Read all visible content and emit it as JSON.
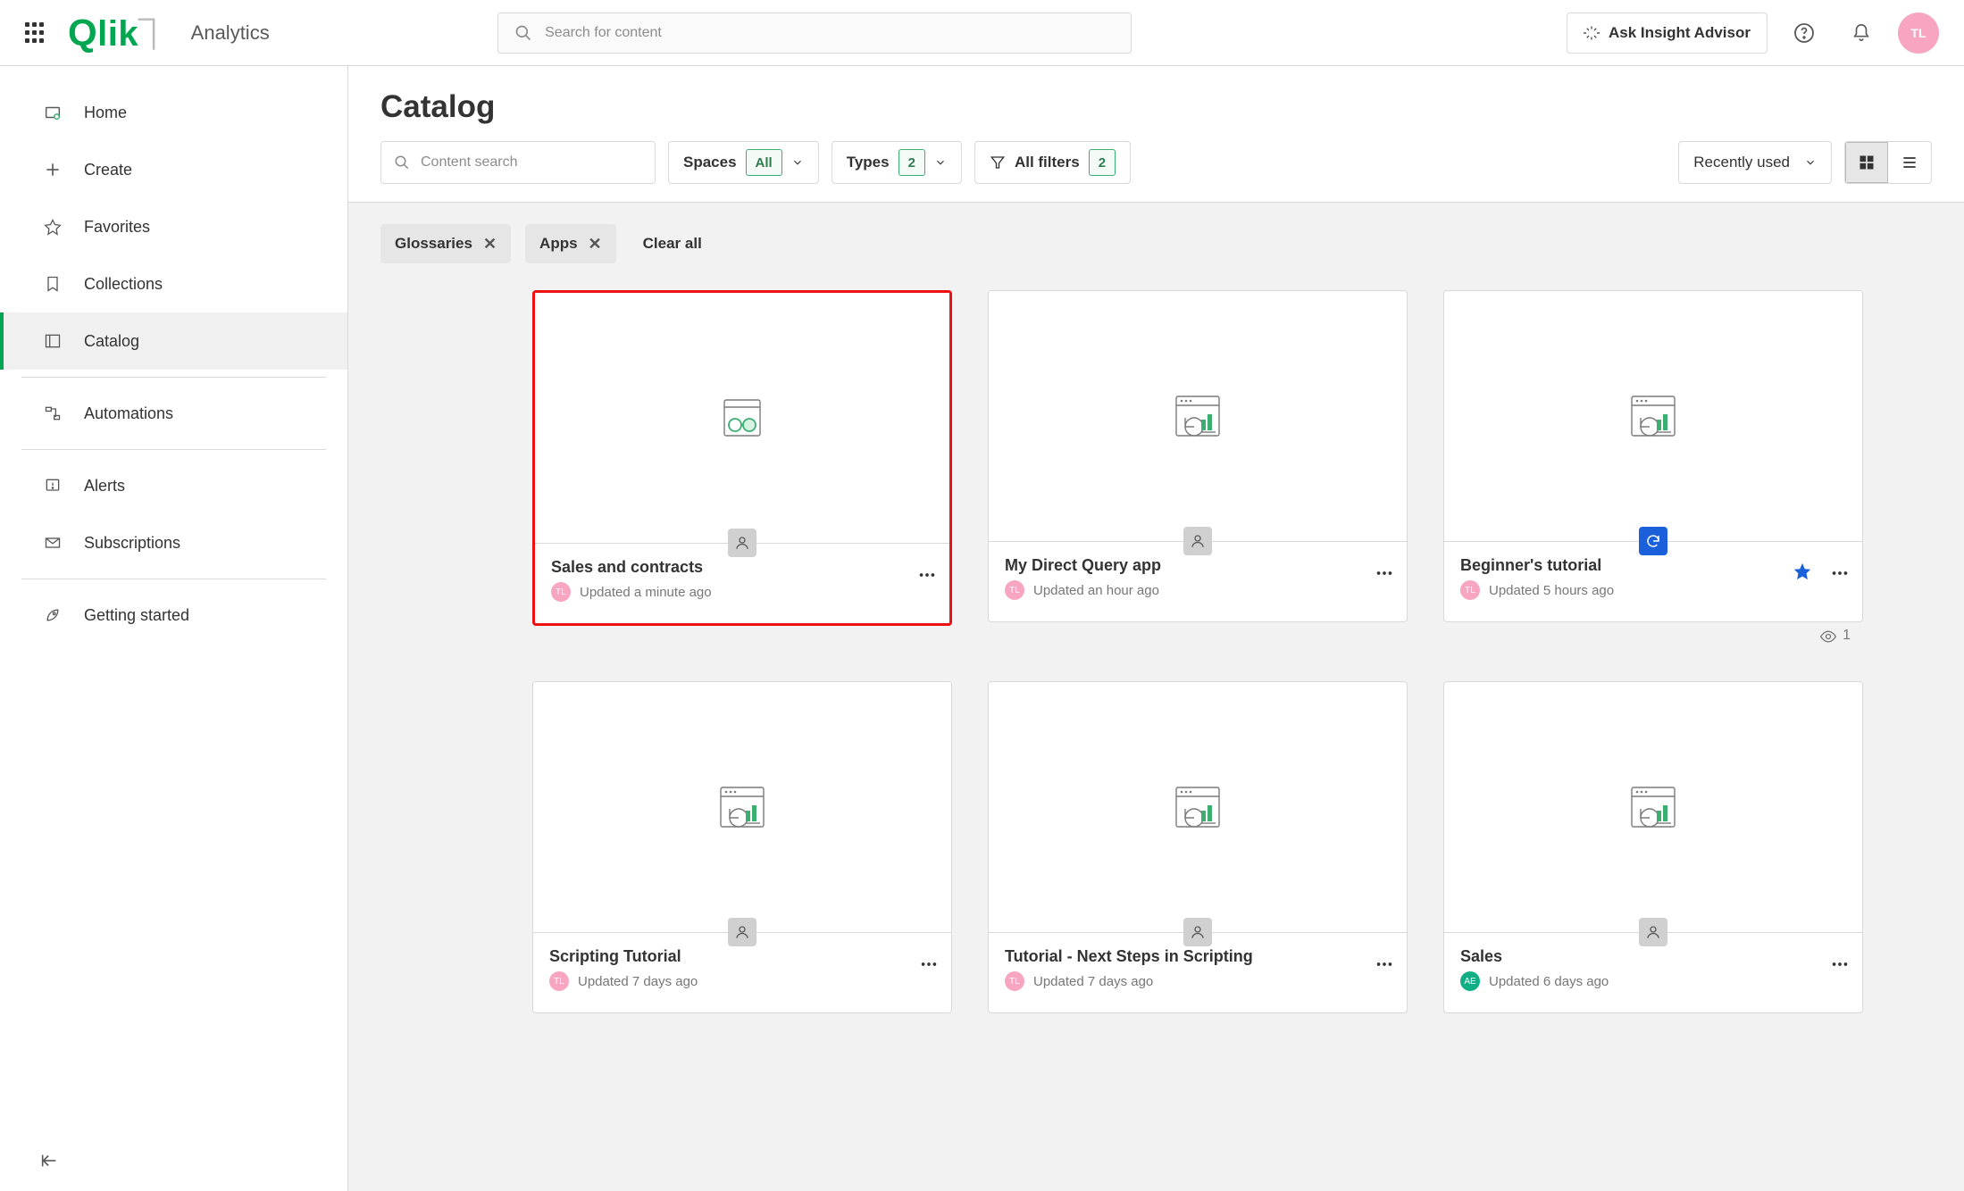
{
  "top": {
    "search_placeholder": "Search for content",
    "ask_label": "Ask Insight Advisor",
    "avatar_initials": "TL",
    "breadcrumb": "Analytics"
  },
  "sidebar": {
    "items": [
      {
        "label": "Home"
      },
      {
        "label": "Create"
      },
      {
        "label": "Favorites"
      },
      {
        "label": "Collections"
      },
      {
        "label": "Catalog"
      },
      {
        "label": "Automations"
      },
      {
        "label": "Alerts"
      },
      {
        "label": "Subscriptions"
      },
      {
        "label": "Getting started"
      }
    ]
  },
  "page": {
    "title": "Catalog",
    "content_search_placeholder": "Content search",
    "spaces_label": "Spaces",
    "spaces_badge": "All",
    "types_label": "Types",
    "types_badge": "2",
    "allfilters_label": "All filters",
    "allfilters_badge": "2",
    "sort_label": "Recently used",
    "tags": [
      {
        "label": "Glossaries"
      },
      {
        "label": "Apps"
      }
    ],
    "clear_all": "Clear all"
  },
  "cards": [
    {
      "title": "Sales and contracts",
      "updated": "Updated a minute ago",
      "av": "TL",
      "av_color": "pink",
      "type": "glossary",
      "highlight": true,
      "badge": "person"
    },
    {
      "title": "My Direct Query app",
      "updated": "Updated an hour ago",
      "av": "TL",
      "av_color": "pink",
      "type": "app",
      "badge": "person"
    },
    {
      "title": "Beginner's tutorial",
      "updated": "Updated 5 hours ago",
      "av": "TL",
      "av_color": "pink",
      "type": "app",
      "badge": "reload",
      "starred": true,
      "views": "1"
    },
    {
      "title": "Scripting Tutorial",
      "updated": "Updated 7 days ago",
      "av": "TL",
      "av_color": "pink",
      "type": "app",
      "badge": "person"
    },
    {
      "title": "Tutorial - Next Steps in Scripting",
      "updated": "Updated 7 days ago",
      "av": "TL",
      "av_color": "pink",
      "type": "app",
      "badge": "person"
    },
    {
      "title": "Sales",
      "updated": "Updated 6 days ago",
      "av": "AE",
      "av_color": "green",
      "type": "app",
      "badge": "person"
    }
  ]
}
